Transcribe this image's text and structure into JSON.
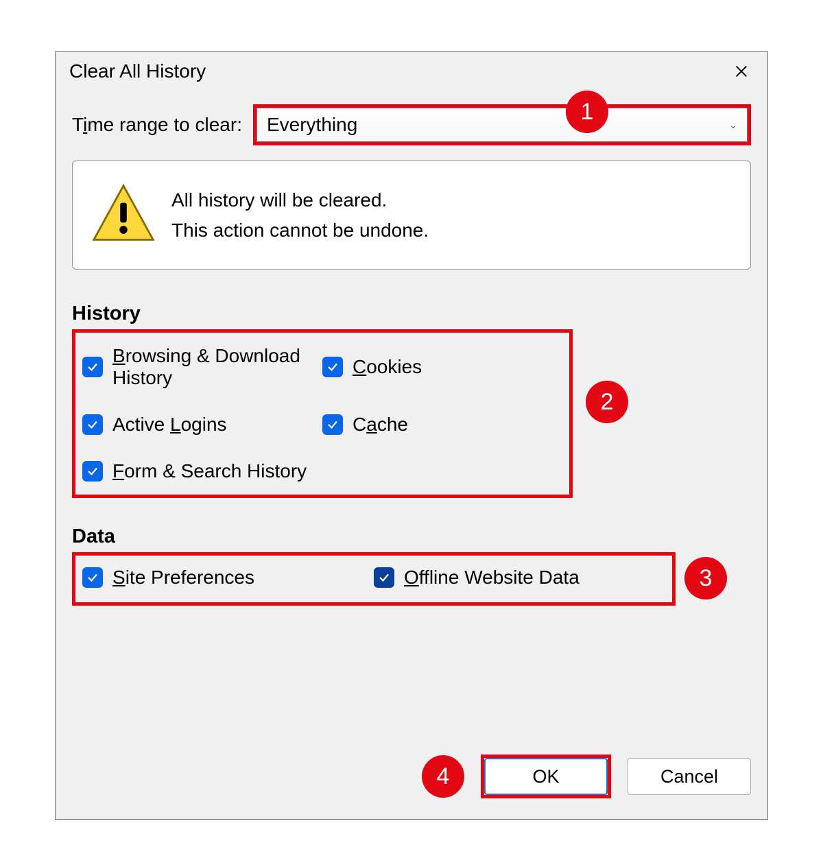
{
  "title": "Clear All History",
  "time_label_pre": "T",
  "time_label_u": "i",
  "time_label_post": "me range to clear:",
  "time_value": "Everything",
  "warn_line1": "All history will be cleared.",
  "warn_line2": "This action cannot be undone.",
  "history_heading": "History",
  "data_heading": "Data",
  "history_items": [
    {
      "pre": "",
      "u": "B",
      "post": "rowsing & Download History"
    },
    {
      "pre": "",
      "u": "C",
      "post": "ookies"
    },
    {
      "pre": "Active ",
      "u": "L",
      "post": "ogins"
    },
    {
      "pre": "C",
      "u": "a",
      "post": "che"
    },
    {
      "pre": "",
      "u": "F",
      "post": "orm & Search History"
    }
  ],
  "data_items": [
    {
      "pre": "",
      "u": "S",
      "post": "ite Preferences"
    },
    {
      "pre": "",
      "u": "O",
      "post": "ffline Website Data"
    }
  ],
  "ok_label": "OK",
  "cancel_label": "Cancel",
  "callouts": {
    "c1": "1",
    "c2": "2",
    "c3": "3",
    "c4": "4"
  }
}
